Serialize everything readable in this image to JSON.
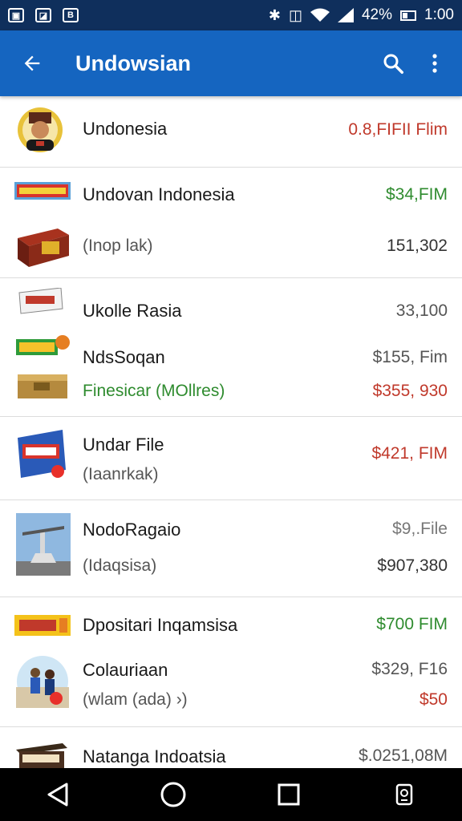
{
  "status_bar": {
    "battery": "42%",
    "time": "1:00"
  },
  "app_bar": {
    "title": "Undowsian"
  },
  "rows": [
    {
      "name": "Undonesia",
      "value": "0.8,FIFII Flim",
      "value_color": "#c0392b"
    },
    {
      "name": "Undovan Indonesia",
      "value": "$34,FIM",
      "value_color": "#2e8b2e"
    },
    {
      "sub": "(Inop lak)",
      "value": "151,302",
      "value_color": "#333333"
    },
    {
      "name": "Ukolle Rasia",
      "value": "33,100",
      "value_color": "#555555"
    },
    {
      "name": "NdsSoqan",
      "value": "$155, Fim",
      "value_color": "#555555"
    },
    {
      "sub": "Finesicar (MOllres)",
      "value": "$355, 930",
      "value_color": "#c0392b"
    },
    {
      "name": "Undar File",
      "value": "$421, FIM",
      "value_color": "#c0392b"
    },
    {
      "sub": "(Iaanrkak)"
    },
    {
      "name": "NodoRagaio",
      "value": "$9,.File",
      "value_color": "#777777"
    },
    {
      "sub": "(Idaqsisa)",
      "value": "$907,380",
      "value_color": "#333333"
    },
    {
      "name": "Dpositari Inqamsisa",
      "value": "$700 FIM",
      "value_color": "#2e8b2e"
    },
    {
      "name": "Colauriaan",
      "value": "$329, F16",
      "value_color": "#555555"
    },
    {
      "sub": "(wlam (ada) ›)",
      "value": "$50",
      "value_color": "#c0392b"
    },
    {
      "name": "Natanga Indoatsia",
      "value": "$.0251,08M",
      "value_color": "#555555"
    }
  ],
  "icons": {
    "status_left": [
      "notification-icon",
      "gallery-icon",
      "app-notification-icon"
    ],
    "status_right": [
      "bluetooth-icon",
      "nfc-icon",
      "wifi-icon",
      "signal-icon",
      "battery-icon"
    ],
    "app_bar": [
      "back-arrow-icon",
      "search-icon",
      "more-vert-icon"
    ],
    "nav": [
      "back-triangle-icon",
      "home-circle-icon",
      "recents-square-icon",
      "screenshot-icon"
    ]
  },
  "colors": {
    "app_bar": "#1565c0",
    "status_bar": "#0f2f5c",
    "green": "#2e8b2e",
    "red": "#c0392b"
  }
}
